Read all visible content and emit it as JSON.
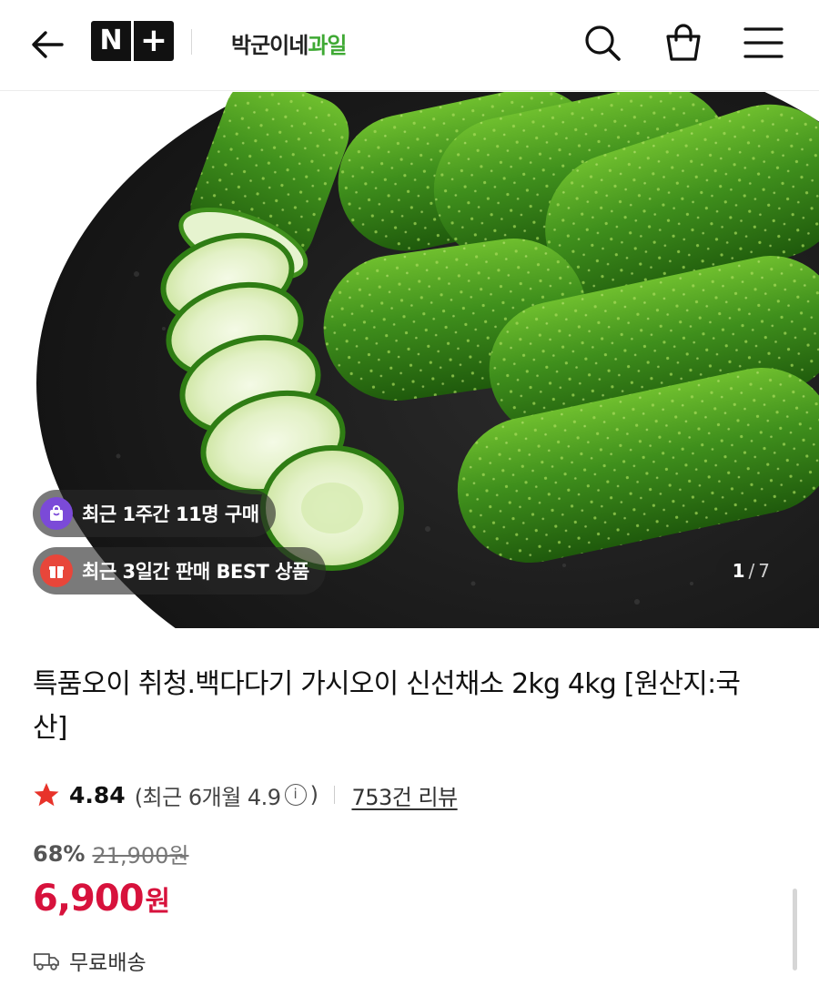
{
  "header": {
    "logo_n": "N",
    "logo_plus": "+",
    "store_name_main": "박군이네",
    "store_name_accent": "과일"
  },
  "hero": {
    "badge_buyers": "최근 1주간 11명 구매",
    "badge_best": "최근 3일간 판매 BEST 상품",
    "counter_current": "1",
    "counter_sep": "/",
    "counter_total": "7"
  },
  "product": {
    "title": "특품오이 취청.백다다기 가시오이 신선채소 2kg 4kg [원산지:국산]",
    "rating": "4.84",
    "rating_recent_prefix": "(최근 6개월 4.9",
    "rating_recent_suffix": ")",
    "info_glyph": "i",
    "reviews": "753건 리뷰",
    "discount": "68%",
    "original_price": "21,900원",
    "price": "6,900",
    "price_unit": "원",
    "shipping": "무료배송"
  },
  "colors": {
    "accent_green": "#3fa934",
    "price_red": "#d7123c",
    "star_red": "#e8332a"
  }
}
